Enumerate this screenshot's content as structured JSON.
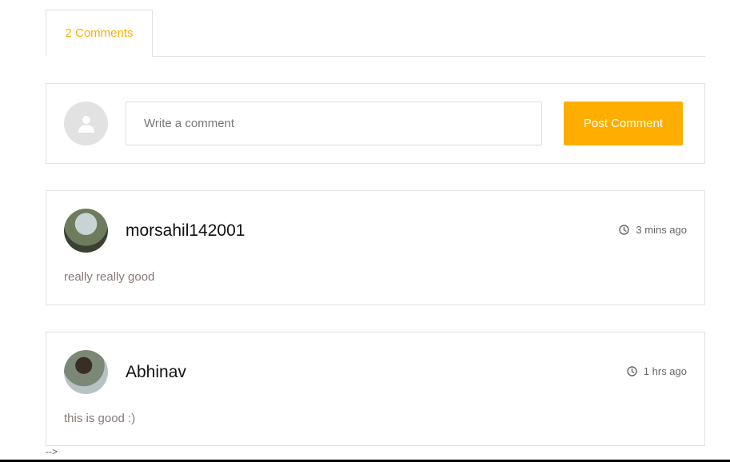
{
  "tabs": {
    "comments_label": "2 Comments"
  },
  "composer": {
    "avatar_icon": "user-icon",
    "input_placeholder": "Write a comment",
    "input_value": "",
    "post_button_label": "Post Comment"
  },
  "comments": [
    {
      "username": "morsahil142001",
      "time": "3 mins ago",
      "text": "really really good",
      "time_icon": "clock-icon"
    },
    {
      "username": "Abhinav",
      "time": "1 hrs ago",
      "text": "this is good :)",
      "time_icon": "clock-icon"
    }
  ],
  "stray_text": "-->",
  "colors": {
    "accent": "#ffae00",
    "border": "#e2e2e2",
    "placeholder_avatar": "#e2e2e2"
  }
}
